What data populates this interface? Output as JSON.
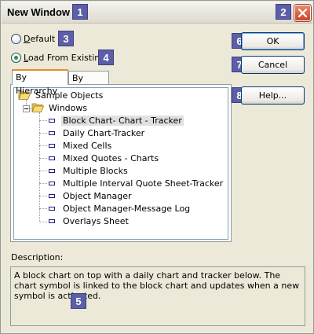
{
  "window": {
    "title": "New Window",
    "close_glyph": "✕"
  },
  "callouts": [
    "1",
    "2",
    "3",
    "4",
    "5",
    "6",
    "7",
    "8"
  ],
  "options": {
    "default_label_key": "D",
    "default_label_rest": "efault",
    "load_label_key": "L",
    "load_label_rest": "oad From Existing",
    "selected": "load"
  },
  "tabs": [
    {
      "label": "By Hierarchy",
      "active": true
    },
    {
      "label": "By Name",
      "active": false
    }
  ],
  "tree": {
    "root": "Sample Objects",
    "folder": "Windows",
    "items": [
      "Block Chart- Chart - Tracker",
      "Daily Chart-Tracker",
      "Mixed Cells",
      "Mixed Quotes - Charts",
      "Multiple Blocks",
      "Multiple Interval Quote Sheet-Tracker",
      "Object Manager",
      "Object Manager-Message Log",
      "Overlays Sheet"
    ],
    "selected_index": 0
  },
  "buttons": {
    "ok": "OK",
    "cancel": "Cancel",
    "help": "Help..."
  },
  "description": {
    "label": "Description:",
    "text": "A block chart on top with a daily chart and tracker below.  The chart symbol is linked to the block chart and updates when a new symbol is activated."
  },
  "colors": {
    "dialog_bg": "#ECE9D8",
    "badge": "#5c5fa8",
    "close_button": "#c8452a",
    "tab_accent": "#e68b2c"
  }
}
